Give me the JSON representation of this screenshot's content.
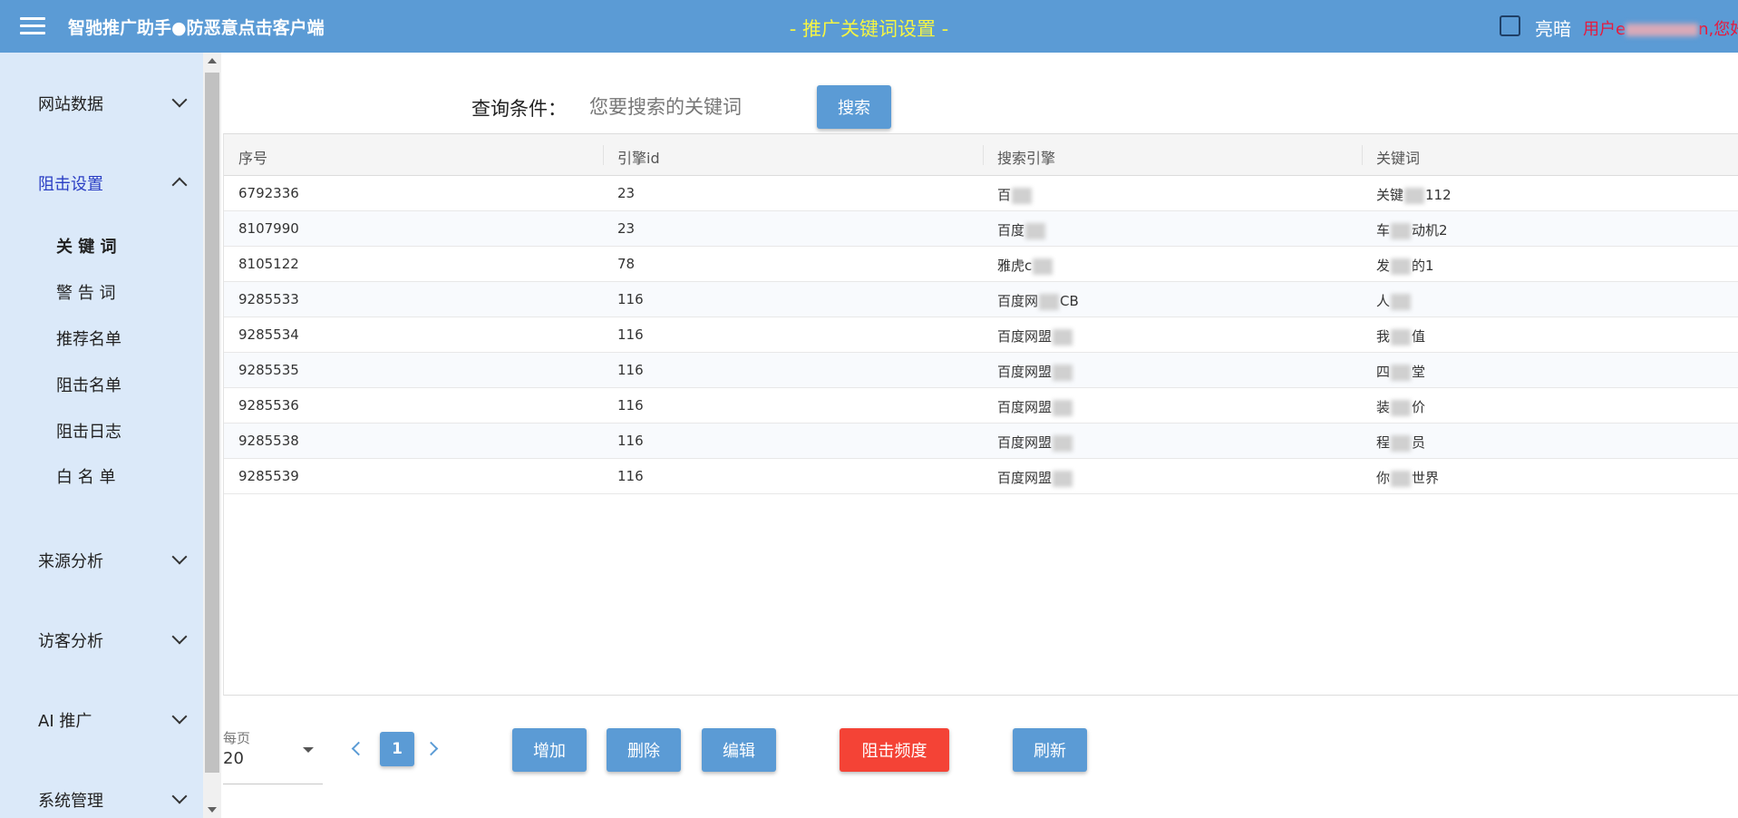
{
  "header": {
    "app_title": "智驰推广助手●防恶意点击客户端",
    "page_title": "- 推广关键词设置 -",
    "theme_label": "亮暗",
    "user_prefix": "用户e",
    "user_suffix": "n,您好!"
  },
  "sidebar": {
    "groups": [
      {
        "label": "网站数据"
      },
      {
        "label": "阻击设置"
      },
      {
        "label": "来源分析"
      },
      {
        "label": "访客分析"
      },
      {
        "label": "AI 推广"
      },
      {
        "label": "系统管理"
      }
    ],
    "sub_items": [
      {
        "label": "关 键 词"
      },
      {
        "label": "警 告 词"
      },
      {
        "label": "推荐名单"
      },
      {
        "label": "阻击名单"
      },
      {
        "label": "阻击日志"
      },
      {
        "label": "白 名 单"
      }
    ]
  },
  "query": {
    "label": "查询条件：",
    "placeholder": "您要搜索的关键词",
    "search_button": "搜索"
  },
  "table": {
    "columns": [
      "序号",
      "引擎id",
      "搜索引擎",
      "关键词"
    ],
    "rows": [
      {
        "id": "6792336",
        "engine_id": "23",
        "engine": "百",
        "keyword_a": "关键",
        "keyword_b": "112"
      },
      {
        "id": "8107990",
        "engine_id": "23",
        "engine": "百度",
        "keyword_a": "车",
        "keyword_b": "动机2"
      },
      {
        "id": "8105122",
        "engine_id": "78",
        "engine": "雅虎c",
        "keyword_a": "发",
        "keyword_b": "的1"
      },
      {
        "id": "9285533",
        "engine_id": "116",
        "engine": "百度网",
        "engine_b": "CB",
        "keyword_a": "人",
        "keyword_b": ""
      },
      {
        "id": "9285534",
        "engine_id": "116",
        "engine": "百度网盟",
        "keyword_a": "我",
        "keyword_b": "值"
      },
      {
        "id": "9285535",
        "engine_id": "116",
        "engine": "百度网盟",
        "keyword_a": "四",
        "keyword_b": "堂"
      },
      {
        "id": "9285536",
        "engine_id": "116",
        "engine": "百度网盟",
        "keyword_a": "装",
        "keyword_b": "价"
      },
      {
        "id": "9285538",
        "engine_id": "116",
        "engine": "百度网盟",
        "keyword_a": "程",
        "keyword_b": "员"
      },
      {
        "id": "9285539",
        "engine_id": "116",
        "engine": "百度网盟",
        "keyword_a": "你",
        "keyword_b": "世界"
      }
    ]
  },
  "pagination": {
    "per_page_label": "每页",
    "per_page_value": "20",
    "current_page": "1"
  },
  "actions": {
    "add": "增加",
    "delete": "删除",
    "edit": "编辑",
    "block_frequency": "阻击频度",
    "refresh": "刷新"
  },
  "icons": {
    "menu": "hamburger-icon",
    "expand": "chevron-down-icon",
    "collapse": "chevron-up-icon",
    "prev": "chevron-left-icon",
    "next": "chevron-right-icon",
    "dropdown": "caret-down-icon"
  },
  "colors": {
    "header_bg": "#5b9bd5",
    "sidebar_bg": "#dbe9f9",
    "page_title": "#f5f543",
    "user_text": "#e8193c",
    "danger": "#f44336",
    "primary": "#5b9bd5"
  }
}
